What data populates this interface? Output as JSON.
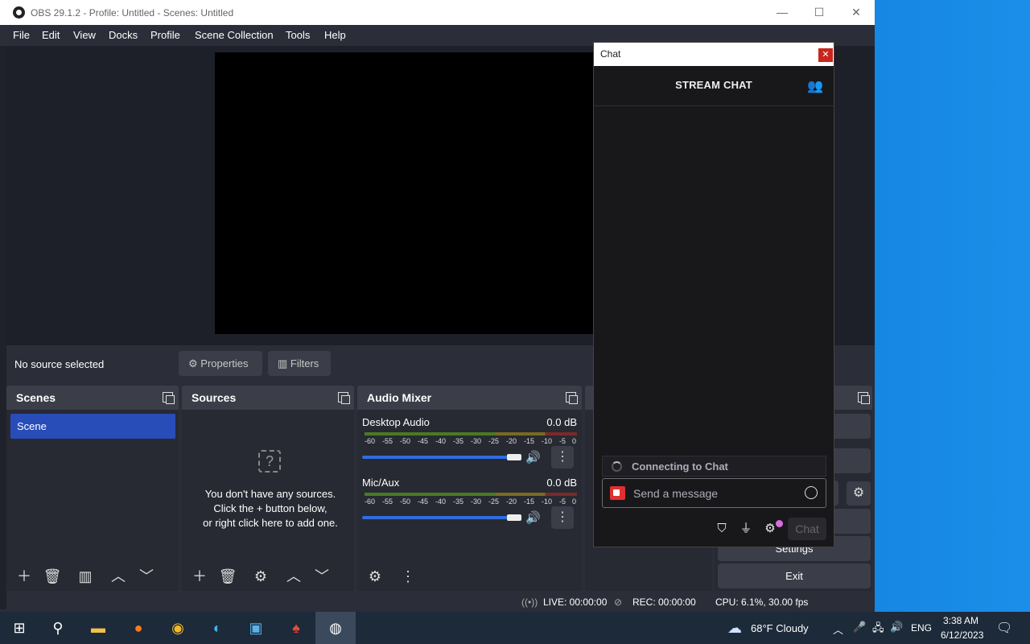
{
  "window": {
    "title": "OBS 29.1.2 - Profile: Untitled - Scenes: Untitled",
    "minimize": "—",
    "maximize": "☐",
    "close": "✕"
  },
  "menu": [
    "File",
    "Edit",
    "View",
    "Docks",
    "Profile",
    "Scene Collection",
    "Tools",
    "Help"
  ],
  "context": {
    "no_source": "No source selected",
    "properties": "Properties",
    "filters": "Filters"
  },
  "scenes": {
    "title": "Scenes",
    "items": [
      "Scene"
    ]
  },
  "sources": {
    "title": "Sources",
    "empty_line1": "You don't have any sources.",
    "empty_line2": "Click the + button below,",
    "empty_line3": "or right click here to add one."
  },
  "mixer": {
    "title": "Audio Mixer",
    "channels": [
      {
        "name": "Desktop Audio",
        "db": "0.0 dB",
        "volume": 1.0
      },
      {
        "name": "Mic/Aux",
        "db": "0.0 dB",
        "volume": 1.0
      }
    ],
    "scale": [
      "-60",
      "-55",
      "-50",
      "-45",
      "-40",
      "-35",
      "-30",
      "-25",
      "-20",
      "-15",
      "-10",
      "-5",
      "0"
    ]
  },
  "controls": {
    "settings": "Settings",
    "exit": "Exit"
  },
  "status": {
    "live": "LIVE: 00:00:00",
    "rec": "REC: 00:00:00",
    "cpu": "CPU: 6.1%, 30.00 fps"
  },
  "chat": {
    "window_title": "Chat",
    "header": "STREAM CHAT",
    "connecting": "Connecting to Chat",
    "placeholder": "Send a message",
    "send": "Chat"
  },
  "taskbar": {
    "weather": "68°F  Cloudy",
    "lang": "ENG",
    "time": "3:38 AM",
    "date": "6/12/2023"
  }
}
